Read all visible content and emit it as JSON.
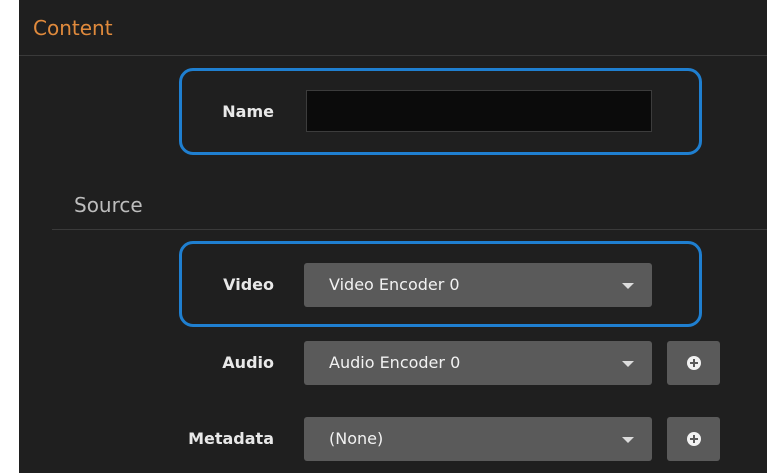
{
  "content": {
    "title": "Content"
  },
  "name": {
    "label": "Name",
    "value": ""
  },
  "source": {
    "title": "Source",
    "video": {
      "label": "Video",
      "selected": "Video Encoder 0"
    },
    "audio": {
      "label": "Audio",
      "selected": "Audio Encoder 0"
    },
    "metadata": {
      "label": "Metadata",
      "selected": "(None)"
    }
  },
  "icons": {
    "dropdown": "chevron-down-icon",
    "add": "plus-circle-icon"
  },
  "colors": {
    "section_title": "#e08a3c",
    "highlight": "#1f7fd0",
    "panel_bg": "#1f1f1f",
    "control_bg": "#5a5a5a"
  }
}
